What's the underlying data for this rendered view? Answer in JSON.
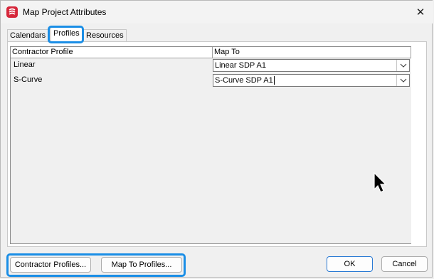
{
  "window": {
    "title": "Map Project Attributes"
  },
  "tabs": [
    {
      "label": "Calendars"
    },
    {
      "label": "Profiles"
    },
    {
      "label": "Resources"
    }
  ],
  "grid": {
    "columns": [
      "Contractor Profile",
      "Map To"
    ],
    "rows": [
      {
        "profile": "Linear",
        "map_to": "Linear SDP A1"
      },
      {
        "profile": "S-Curve",
        "map_to": "S-Curve SDP A1"
      }
    ]
  },
  "buttons": {
    "contractor_profiles": "Contractor Profiles...",
    "map_to_profiles": "Map To Profiles...",
    "ok": "OK",
    "cancel": "Cancel"
  },
  "colors": {
    "highlight": "#1a8ee6",
    "app_icon": "#d6273b"
  },
  "icons": [
    "app-icon",
    "close-icon",
    "chevron-down-icon",
    "mouse-pointer-icon"
  ]
}
